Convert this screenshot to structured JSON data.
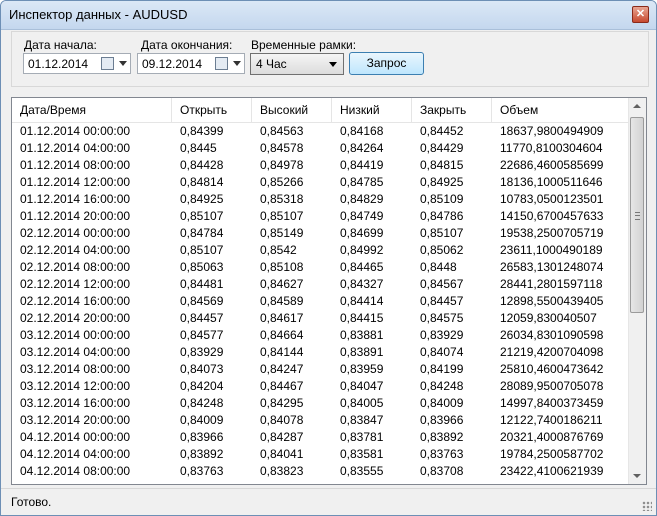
{
  "window": {
    "title": "Инспектор данных - AUDUSD",
    "close_glyph": "✕"
  },
  "filters": {
    "start_label": "Дата начала:",
    "start_value": "01.12.2014",
    "end_label": "Дата окончания:",
    "end_value": "09.12.2014",
    "timeframe_label": "Временные рамки:",
    "timeframe_value": "4 Час",
    "query_button": "Запрос"
  },
  "grid": {
    "columns": [
      "Дата/Время",
      "Открыть",
      "Высокий",
      "Низкий",
      "Закрыть",
      "Объем"
    ],
    "rows": [
      [
        "01.12.2014 00:00:00",
        "0,84399",
        "0,84563",
        "0,84168",
        "0,84452",
        "18637,9800494909"
      ],
      [
        "01.12.2014 04:00:00",
        "0,8445",
        "0,84578",
        "0,84264",
        "0,84429",
        "11770,8100304604"
      ],
      [
        "01.12.2014 08:00:00",
        "0,84428",
        "0,84978",
        "0,84419",
        "0,84815",
        "22686,4600585699"
      ],
      [
        "01.12.2014 12:00:00",
        "0,84814",
        "0,85266",
        "0,84785",
        "0,84925",
        "18136,1000511646"
      ],
      [
        "01.12.2014 16:00:00",
        "0,84925",
        "0,85318",
        "0,84829",
        "0,85109",
        "10783,0500123501"
      ],
      [
        "01.12.2014 20:00:00",
        "0,85107",
        "0,85107",
        "0,84749",
        "0,84786",
        "14150,6700457633"
      ],
      [
        "02.12.2014 00:00:00",
        "0,84784",
        "0,85149",
        "0,84699",
        "0,85107",
        "19538,2500705719"
      ],
      [
        "02.12.2014 04:00:00",
        "0,85107",
        "0,8542",
        "0,84992",
        "0,85062",
        "23611,1000490189"
      ],
      [
        "02.12.2014 08:00:00",
        "0,85063",
        "0,85108",
        "0,84465",
        "0,8448",
        "26583,1301248074"
      ],
      [
        "02.12.2014 12:00:00",
        "0,84481",
        "0,84627",
        "0,84327",
        "0,84567",
        "28441,2801597118"
      ],
      [
        "02.12.2014 16:00:00",
        "0,84569",
        "0,84589",
        "0,84414",
        "0,84457",
        "12898,5500439405"
      ],
      [
        "02.12.2014 20:00:00",
        "0,84457",
        "0,84617",
        "0,84415",
        "0,84575",
        "12059,830040507"
      ],
      [
        "03.12.2014 00:00:00",
        "0,84577",
        "0,84664",
        "0,83881",
        "0,83929",
        "26034,8301090598"
      ],
      [
        "03.12.2014 04:00:00",
        "0,83929",
        "0,84144",
        "0,83891",
        "0,84074",
        "21219,4200704098"
      ],
      [
        "03.12.2014 08:00:00",
        "0,84073",
        "0,84247",
        "0,83959",
        "0,84199",
        "25810,4600473642"
      ],
      [
        "03.12.2014 12:00:00",
        "0,84204",
        "0,84467",
        "0,84047",
        "0,84248",
        "28089,9500705078"
      ],
      [
        "03.12.2014 16:00:00",
        "0,84248",
        "0,84295",
        "0,84005",
        "0,84009",
        "14997,8400373459"
      ],
      [
        "03.12.2014 20:00:00",
        "0,84009",
        "0,84078",
        "0,83847",
        "0,83966",
        "12122,7400186211"
      ],
      [
        "04.12.2014 00:00:00",
        "0,83966",
        "0,84287",
        "0,83781",
        "0,83892",
        "20321,4000876769"
      ],
      [
        "04.12.2014 04:00:00",
        "0,83892",
        "0,84041",
        "0,83581",
        "0,83763",
        "19784,2500587702"
      ],
      [
        "04.12.2014 08:00:00",
        "0,83763",
        "0,83823",
        "0,83555",
        "0,83708",
        "23422,4100621939"
      ]
    ]
  },
  "status": {
    "text": "Готово."
  }
}
